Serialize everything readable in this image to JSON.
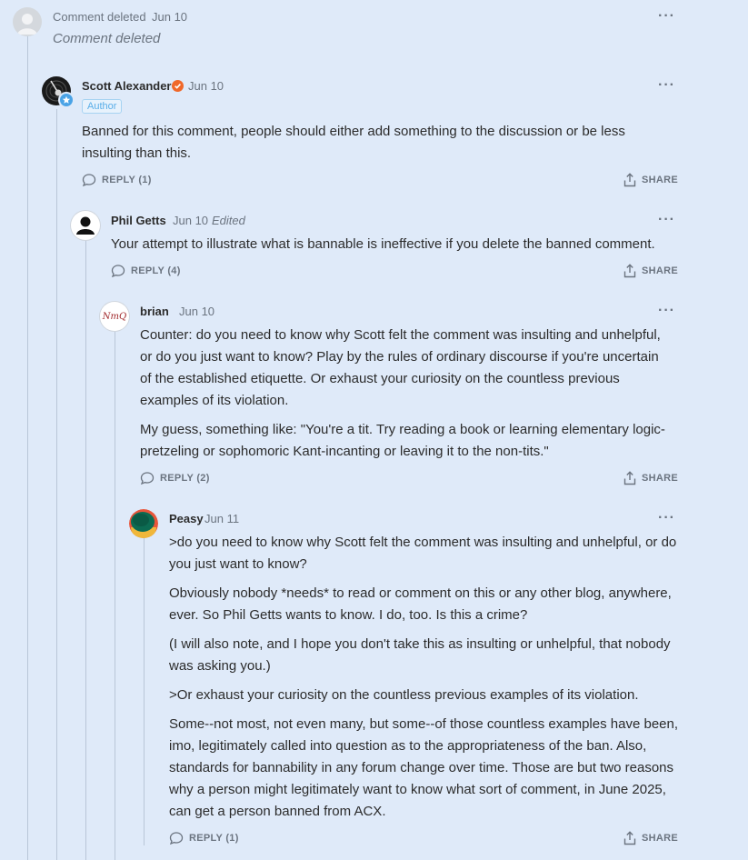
{
  "comments": [
    {
      "name": "Comment deleted",
      "date": "Jun 10",
      "body": [
        "Comment deleted"
      ]
    },
    {
      "name": "Scott Alexander",
      "date": "Jun 10",
      "badge": "Author",
      "body": [
        "Banned for this comment, people should either add something to the discussion or be less insulting than this."
      ],
      "reply_label": "REPLY (1)",
      "share_label": "SHARE"
    },
    {
      "name": "Phil Getts",
      "date": "Jun 10",
      "edited": "Edited",
      "body": [
        "Your attempt to illustrate what is bannable is ineffective if you delete the banned comment."
      ],
      "reply_label": "REPLY (4)",
      "share_label": "SHARE"
    },
    {
      "name": "brian",
      "date": "Jun 10",
      "avatar_text": "NmQ",
      "body": [
        "Counter: do you need to know why Scott felt the comment was insulting and unhelpful, or do you just want to know? Play by the rules of ordinary discourse if you're uncertain of the established etiquette. Or exhaust your curiosity on the countless previous examples of its violation.",
        "My guess, something like: \"You're a tit. Try reading a book or learning elementary logic-pretzeling or sophomoric Kant-incanting or leaving it to the non-tits.\""
      ],
      "reply_label": "REPLY (2)",
      "share_label": "SHARE"
    },
    {
      "name": "Peasy",
      "date": "Jun 11",
      "body": [
        ">do you need to know why Scott felt the comment was insulting and unhelpful, or do you just want to know?",
        "Obviously nobody *needs* to read or comment on this or any other blog, anywhere, ever. So Phil Getts wants to know. I do, too. Is this a crime?",
        "(I will also note, and I hope you don't take this as insulting or unhelpful, that nobody was asking you.)",
        ">Or exhaust your curiosity on the countless previous examples of its violation.",
        "Some--not most, not even many, but some--of those countless examples have been, imo, legitimately called into question as to the appropriateness of the ban. Also, standards for bannability in any forum change over time. Those are but two reasons why a person might legitimately want to know what sort of comment, in June 2025, can get a person banned from ACX."
      ],
      "reply_label": "REPLY (1)",
      "share_label": "SHARE"
    }
  ],
  "more_glyph": "···",
  "colors": {
    "background": "#dfeaf9",
    "verified_orange": "#f0682a",
    "author_badge_blue": "#5aaee8",
    "meta_gray": "#6b7480"
  }
}
